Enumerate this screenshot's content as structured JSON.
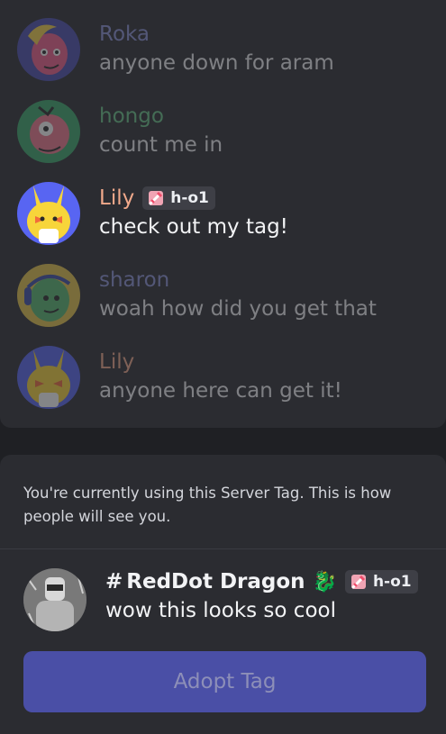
{
  "messages": [
    {
      "username": "Roka",
      "color": "#8b93d8",
      "text": "anyone down for aram",
      "faded": true,
      "tag": null
    },
    {
      "username": "hongo",
      "color": "#67c487",
      "text": "count me in",
      "faded": true,
      "tag": null
    },
    {
      "username": "Lily",
      "color": "#f1a98b",
      "text": "check out my tag!",
      "faded": false,
      "tag": "h-o1"
    },
    {
      "username": "sharon",
      "color": "#8b93d8",
      "text": "woah how did you get that",
      "faded": true,
      "tag": null
    },
    {
      "username": "Lily",
      "color": "#f1a98b",
      "text": "anyone here can get it!",
      "faded": true,
      "tag": null
    }
  ],
  "info": {
    "text": "You're currently using this Server Tag. This is how people will see you."
  },
  "preview": {
    "hash": "#",
    "username": "RedDot Dragon",
    "dragon_emoji": "🐉",
    "tag": "h-o1",
    "text": "wow this looks so cool"
  },
  "adopt_button": {
    "label": "Adopt Tag"
  },
  "colors": {
    "button": "#4a4fa6",
    "card": "#2b2c31",
    "background": "#1f2024"
  },
  "icons": [
    "sword-icon",
    "dragon-emoji"
  ]
}
